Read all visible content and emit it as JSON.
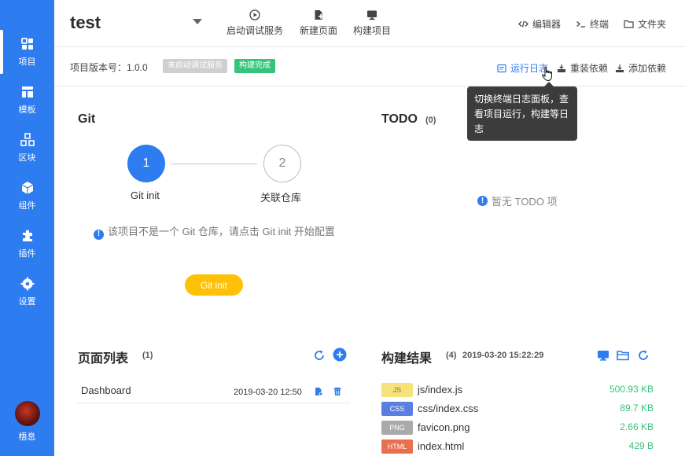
{
  "sidebar": {
    "items": [
      {
        "label": "项目",
        "icon": "dashboard-icon"
      },
      {
        "label": "模板",
        "icon": "template-icon"
      },
      {
        "label": "区块",
        "icon": "blocks-icon"
      },
      {
        "label": "组件",
        "icon": "cube-icon"
      },
      {
        "label": "插件",
        "icon": "puzzle-icon"
      },
      {
        "label": "设置",
        "icon": "gear-icon"
      }
    ],
    "user_name": "梧息"
  },
  "header": {
    "title": "test",
    "actions": {
      "start_debug": "启动调试服务",
      "new_page": "新建页面",
      "build": "构建项目"
    },
    "links": {
      "editor": "编辑器",
      "terminal": "终端",
      "folder": "文件夹"
    }
  },
  "subbar": {
    "version": "项目版本号：1.0.0",
    "status_debug": "未启动调试服务",
    "status_build": "构建完成",
    "run_log": "运行日志",
    "reinstall": "重装依赖",
    "add_dep": "添加依赖"
  },
  "tooltip": {
    "text": "切换终端日志面板，查看项目运行，构建等日志"
  },
  "git": {
    "title": "Git",
    "steps": [
      {
        "num": "1",
        "label": "Git init"
      },
      {
        "num": "2",
        "label": "关联仓库"
      }
    ],
    "message": "该项目不是一个 Git 仓库，请点击 Git init 开始配置",
    "button": "Git init"
  },
  "todo": {
    "title": "TODO",
    "count": "(0)",
    "empty": "暂无 TODO 项"
  },
  "pages": {
    "title": "页面列表",
    "count": "(1)",
    "rows": [
      {
        "name": "Dashboard",
        "time": "2019-03-20 12:50"
      }
    ]
  },
  "build": {
    "title": "构建结果",
    "count": "(4)",
    "time": "2019-03-20 15:22:29",
    "files": [
      {
        "tag": "JS",
        "name": "js/index.js",
        "size": "500.93 KB",
        "color": "#f5e27a"
      },
      {
        "tag": "CSS",
        "name": "css/index.css",
        "size": "89.7 KB",
        "color": "#5b7fe0"
      },
      {
        "tag": "PNG",
        "name": "favicon.png",
        "size": "2.66 KB",
        "color": "#aaaaaa"
      },
      {
        "tag": "HTML",
        "name": "index.html",
        "size": "429 B",
        "color": "#e8704f"
      }
    ]
  },
  "colors": {
    "primary": "#2d7cf0",
    "success": "#35c47c",
    "warning": "#ffc107"
  }
}
